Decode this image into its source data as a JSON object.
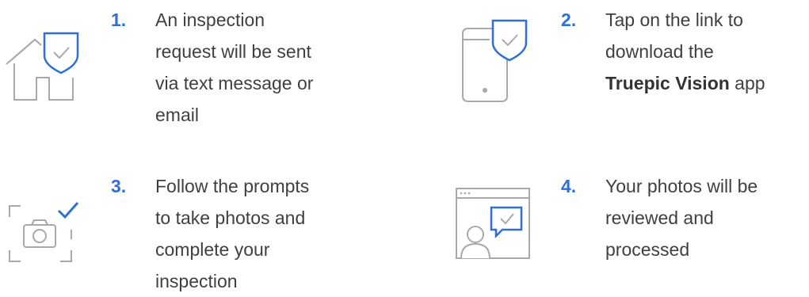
{
  "colors": {
    "accent": "#2f6fd6",
    "icon_gray": "#a9a9a9",
    "text": "#3f3f3f"
  },
  "steps": [
    {
      "number": "1.",
      "icon": "house-shield-check-icon",
      "lines": [
        "An inspection",
        "request will be sent",
        "via text message or",
        "email"
      ]
    },
    {
      "number": "2.",
      "icon": "phone-shield-check-icon",
      "lines": [
        "Tap on the link to",
        "download the"
      ],
      "bold": "Truepic Vision",
      "after_bold": " app"
    },
    {
      "number": "3.",
      "icon": "camera-frame-check-icon",
      "lines": [
        "Follow the prompts",
        "to take photos and",
        "complete your",
        "inspection"
      ]
    },
    {
      "number": "4.",
      "icon": "browser-person-review-icon",
      "lines": [
        "Your photos will be",
        "reviewed and",
        "processed"
      ]
    }
  ]
}
